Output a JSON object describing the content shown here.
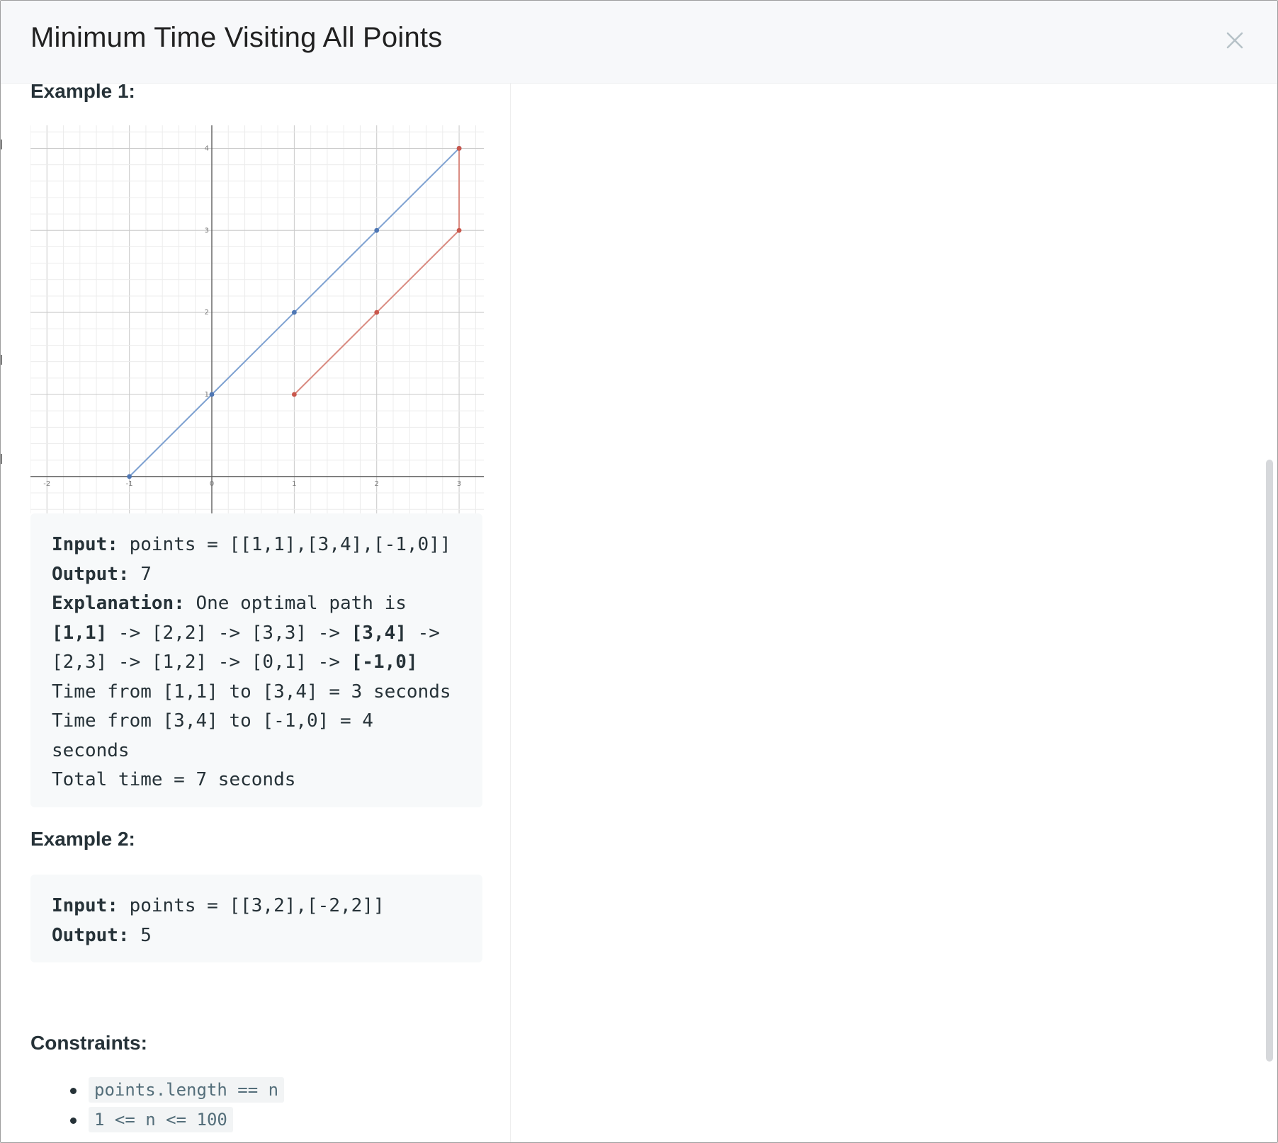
{
  "modal": {
    "title": "Minimum Time Visiting All Points",
    "close_icon": "close-icon"
  },
  "example1": {
    "heading": "Example 1:",
    "input_label": "Input:",
    "input_value": " points = [[1,1],[3,4],[-1,0]]",
    "output_label": "Output:",
    "output_value": " 7",
    "explanation_label": "Explanation:",
    "explanation_text": " One optimal path is",
    "path_line1": {
      "p1": "[1,1]",
      "t1": " -> [2,2] -> [3,3] -> ",
      "p2": "[3,4]",
      "t2": " ->"
    },
    "path_line2": {
      "t1": "[2,3] -> [1,2] -> [0,1] -> ",
      "p3": "[-1,0]"
    },
    "time_line1": "Time from [1,1] to [3,4] = 3 seconds",
    "time_line2": "Time from [3,4] to [-1,0] = 4",
    "time_line3": "seconds",
    "total_line": "Total time = 7 seconds"
  },
  "example2": {
    "heading": "Example 2:",
    "input_label": "Input:",
    "input_value": " points = [[3,2],[-2,2]]",
    "output_label": "Output:",
    "output_value": " 5"
  },
  "constraints": {
    "heading": "Constraints:",
    "items": [
      "points.length == n",
      "1 <= n <= 100"
    ]
  },
  "chart_data": {
    "type": "line",
    "title": "",
    "xlabel": "",
    "ylabel": "",
    "xlim": [
      -2.2,
      3.3
    ],
    "ylim": [
      -0.45,
      4.28
    ],
    "x_ticks": [
      "-2",
      "-1",
      "0",
      "1",
      "2",
      "3"
    ],
    "y_ticks": [
      "1",
      "2",
      "3",
      "4"
    ],
    "grid": true,
    "series": [
      {
        "color": "#7ea1d1",
        "point_color": "#4f77b4",
        "x": [
          -1,
          0,
          1,
          2,
          3
        ],
        "y": [
          0,
          1,
          2,
          3,
          4
        ]
      },
      {
        "color": "#d98a80",
        "point_color": "#c9574c",
        "x": [
          1,
          2,
          3,
          3
        ],
        "y": [
          1,
          2,
          3,
          4
        ]
      }
    ]
  }
}
